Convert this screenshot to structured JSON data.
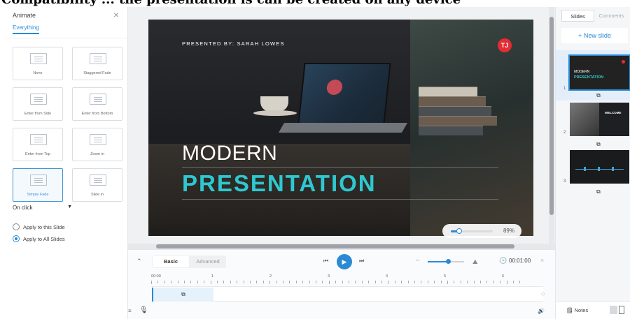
{
  "caption_fragment": "Compatibility ... the presentation is can be created on any device",
  "left_panel": {
    "title": "Animate",
    "tab": "Everything",
    "effects": [
      {
        "label": "None",
        "selected": false
      },
      {
        "label": "Staggered Fade",
        "selected": false
      },
      {
        "label": "Enter from Side",
        "selected": false
      },
      {
        "label": "Enter from Bottom",
        "selected": false
      },
      {
        "label": "Enter from Top",
        "selected": false
      },
      {
        "label": "Zoom in",
        "selected": false
      },
      {
        "label": "Simple Fade",
        "selected": true
      },
      {
        "label": "Slide in",
        "selected": false
      }
    ],
    "trigger": "On click",
    "apply_options": [
      {
        "label": "Apply to this Slide",
        "checked": false
      },
      {
        "label": "Apply to All Slides",
        "checked": true
      }
    ]
  },
  "slide": {
    "presented_by": "PRESENTED BY: SARAH LOWES",
    "title_line1": "MODERN",
    "title_line2": "PRESENTATION",
    "logo_text": "TJ",
    "accent": "#2ec8d0",
    "zoom": "89%",
    "zoom_fraction": 0.2
  },
  "timeline": {
    "modes": {
      "basic": "Basic",
      "advanced": "Advanced"
    },
    "time": "00:01:00",
    "volume_fraction": 0.55,
    "ruler": [
      "00:00",
      "1",
      "2",
      "3",
      "4",
      "5",
      "6"
    ]
  },
  "right_panel": {
    "tabs": {
      "slides": "Slides",
      "comments": "Comments"
    },
    "new_slide": "+ New slide",
    "slides": [
      {
        "number": "1",
        "line1": "MODERN",
        "line2": "PRESENTATION",
        "selected": true
      },
      {
        "number": "2",
        "heading": "WELCOME",
        "selected": false
      },
      {
        "number": "3",
        "selected": false
      }
    ],
    "notes": "Notes"
  },
  "colors": {
    "accent_blue": "#2a8ad4",
    "teal": "#2ec8d0",
    "logo_red": "#e32c35"
  }
}
